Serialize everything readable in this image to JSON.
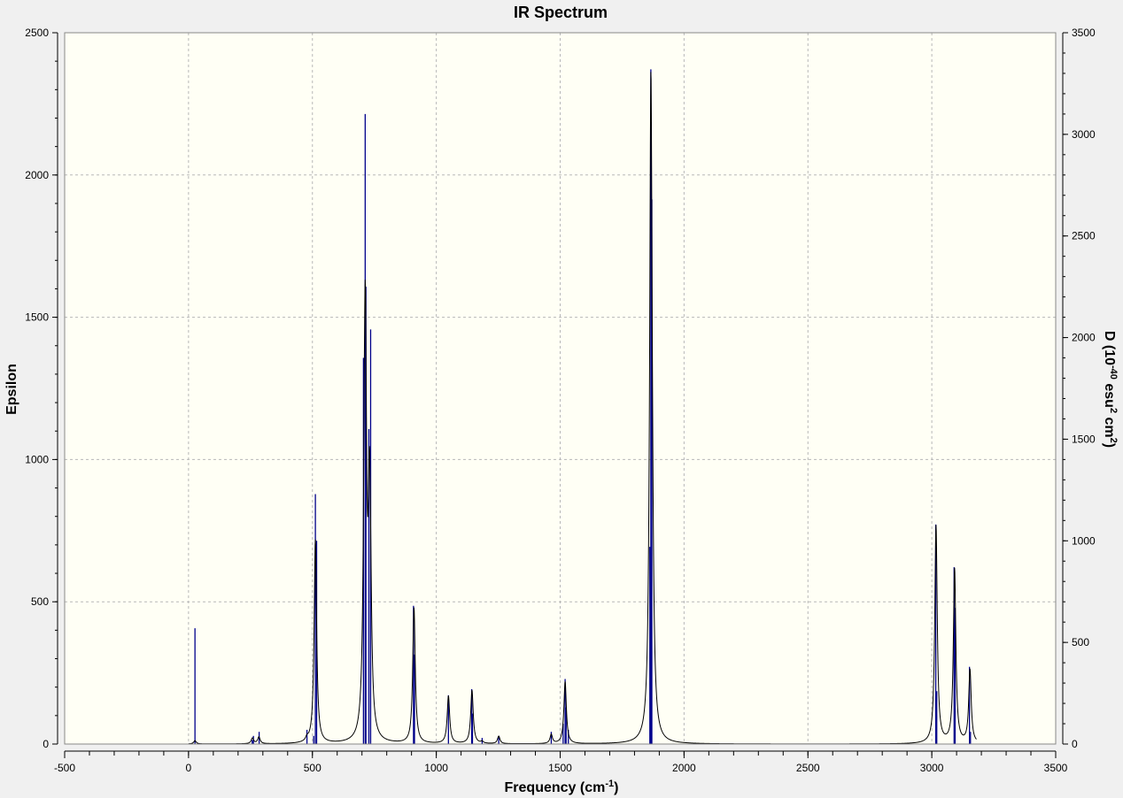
{
  "chart_data": {
    "type": "line",
    "title": "IR Spectrum",
    "xlabel": {
      "main": "Frequency (cm",
      "sup": "-1",
      "end": ")"
    },
    "ylabel_left": "Epsilon",
    "ylabel_right": {
      "p1": "D (10",
      "s1": "-40",
      "p2": " esu",
      "s2": "2",
      "p3": " cm",
      "s3": "2",
      "p4": ")"
    },
    "xlim": [
      -500,
      3500
    ],
    "ylim_left": [
      0,
      2500
    ],
    "ylim_right": [
      0,
      3500
    ],
    "x_ticks": [
      -500,
      0,
      500,
      1000,
      1500,
      2000,
      2500,
      3000,
      3500
    ],
    "y_left_ticks": [
      0,
      500,
      1000,
      1500,
      2000,
      2500
    ],
    "y_right_ticks": [
      0,
      500,
      1000,
      1500,
      2000,
      2500,
      3000,
      3500
    ],
    "grid": true,
    "colors": {
      "plot_background": "#fffff5",
      "spectrum_line": "#000000",
      "stick_lines": "#00008b"
    },
    "sticks_note": "stick intensities in D units (right axis)",
    "sticks": [
      {
        "x": 26,
        "d": 570
      },
      {
        "x": 257,
        "d": 20
      },
      {
        "x": 262,
        "d": 40
      },
      {
        "x": 285,
        "d": 60
      },
      {
        "x": 478,
        "d": 70
      },
      {
        "x": 505,
        "d": 40
      },
      {
        "x": 512,
        "d": 1230
      },
      {
        "x": 517,
        "d": 1000
      },
      {
        "x": 706,
        "d": 1900
      },
      {
        "x": 713,
        "d": 3100
      },
      {
        "x": 716,
        "d": 2250
      },
      {
        "x": 728,
        "d": 1550
      },
      {
        "x": 735,
        "d": 2040
      },
      {
        "x": 908,
        "d": 680
      },
      {
        "x": 912,
        "d": 440
      },
      {
        "x": 1049,
        "d": 240
      },
      {
        "x": 1143,
        "d": 270
      },
      {
        "x": 1146,
        "d": 150
      },
      {
        "x": 1185,
        "d": 30
      },
      {
        "x": 1252,
        "d": 40
      },
      {
        "x": 1464,
        "d": 60
      },
      {
        "x": 1512,
        "d": 100
      },
      {
        "x": 1520,
        "d": 320
      },
      {
        "x": 1524,
        "d": 180
      },
      {
        "x": 1533,
        "d": 70
      },
      {
        "x": 1862,
        "d": 970
      },
      {
        "x": 1866,
        "d": 3320
      },
      {
        "x": 1870,
        "d": 2680
      },
      {
        "x": 3016,
        "d": 1080
      },
      {
        "x": 3020,
        "d": 260
      },
      {
        "x": 3090,
        "d": 870
      },
      {
        "x": 3094,
        "d": 670
      },
      {
        "x": 3152,
        "d": 380
      },
      {
        "x": 3156,
        "d": 60
      }
    ],
    "spectrum_peaks": [
      {
        "x": 26,
        "eps": 12
      },
      {
        "x": 258,
        "eps": 22
      },
      {
        "x": 284,
        "eps": 26
      },
      {
        "x": 478,
        "eps": 35
      },
      {
        "x": 512,
        "eps": 720
      },
      {
        "x": 516,
        "eps": 360
      },
      {
        "x": 710,
        "eps": 1390
      },
      {
        "x": 714,
        "eps": 1620
      },
      {
        "x": 730,
        "eps": 1050
      },
      {
        "x": 735,
        "eps": 760
      },
      {
        "x": 910,
        "eps": 480
      },
      {
        "x": 1049,
        "eps": 170
      },
      {
        "x": 1144,
        "eps": 190
      },
      {
        "x": 1185,
        "eps": 12
      },
      {
        "x": 1252,
        "eps": 28
      },
      {
        "x": 1464,
        "eps": 35
      },
      {
        "x": 1520,
        "eps": 220
      },
      {
        "x": 1533,
        "eps": 25
      },
      {
        "x": 1866,
        "eps": 2370
      },
      {
        "x": 1871,
        "eps": 1550
      },
      {
        "x": 3017,
        "eps": 770
      },
      {
        "x": 3092,
        "eps": 620
      },
      {
        "x": 3154,
        "eps": 265
      }
    ]
  }
}
